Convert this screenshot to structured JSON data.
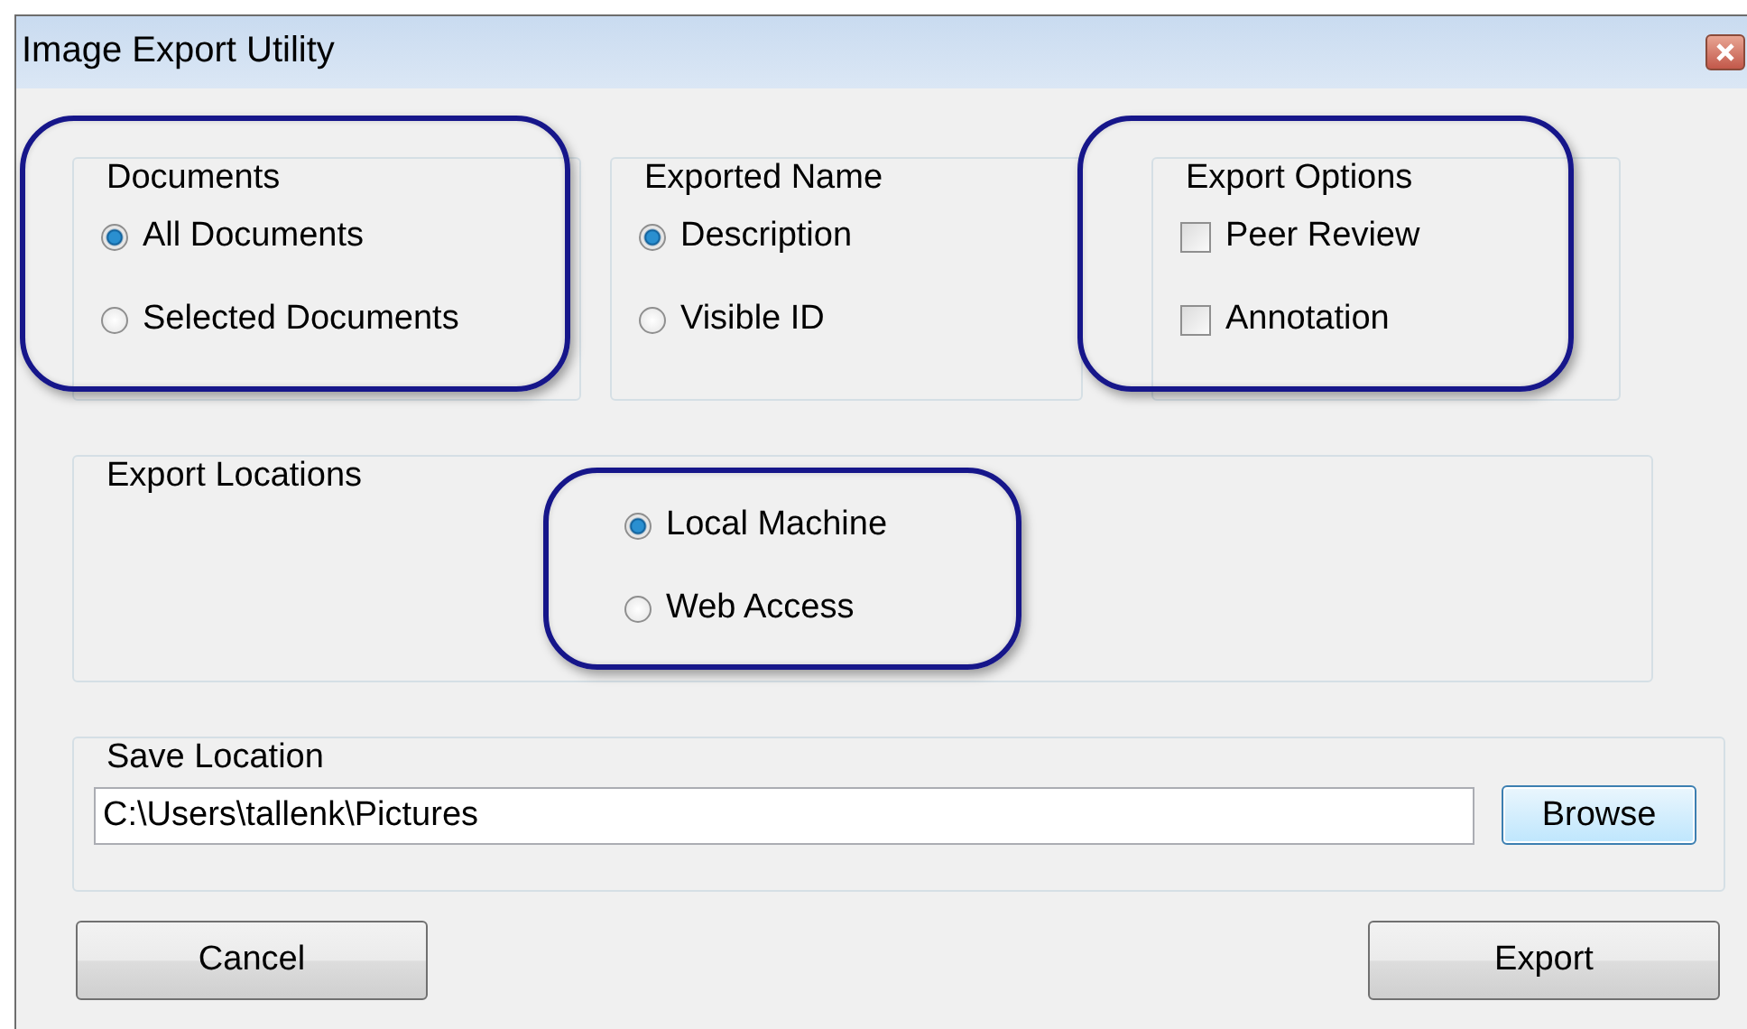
{
  "window": {
    "title": "Image Export Utility"
  },
  "option_groups": [
    {
      "title": "Documents",
      "highlighted": true,
      "options": [
        {
          "kind": "radio",
          "label": "All Documents",
          "selected": true
        },
        {
          "kind": "radio",
          "label": "Selected Documents",
          "selected": false
        }
      ]
    },
    {
      "title": "Exported Name",
      "highlighted": false,
      "options": [
        {
          "kind": "radio",
          "label": "Description",
          "selected": true
        },
        {
          "kind": "radio",
          "label": "Visible ID",
          "selected": false
        }
      ]
    },
    {
      "title": "Export Options",
      "highlighted": true,
      "options": [
        {
          "kind": "checkbox",
          "label": "Peer Review",
          "checked": false
        },
        {
          "kind": "checkbox",
          "label": "Annotation",
          "checked": false
        }
      ]
    }
  ],
  "export_locations": {
    "title": "Export Locations",
    "highlighted": true,
    "options": [
      {
        "kind": "radio",
        "label": "Local Machine",
        "selected": true
      },
      {
        "kind": "radio",
        "label": "Web Access",
        "selected": false
      }
    ]
  },
  "save_location": {
    "title": "Save Location",
    "value": "C:\\Users\\tallenk\\Pictures",
    "browse_button": "Browse"
  },
  "buttons": {
    "cancel": "Cancel",
    "export": "Export"
  }
}
